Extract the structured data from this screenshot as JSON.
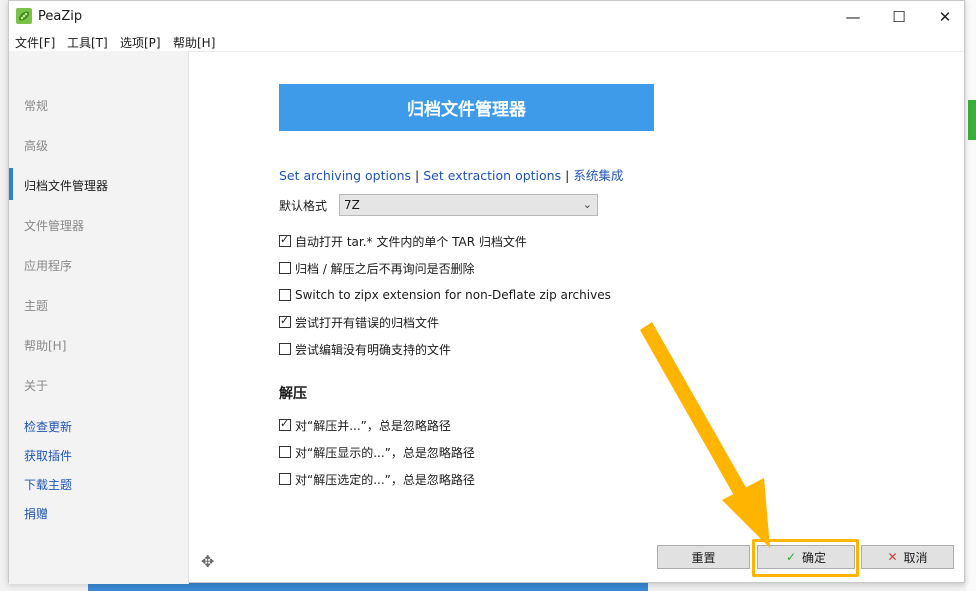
{
  "window": {
    "title": "PeaZip",
    "controls": {
      "minimize": "—",
      "maximize": "☐",
      "close": "✕"
    }
  },
  "menu": [
    "文件[F]",
    "工具[T]",
    "选项[P]",
    "帮助[H]"
  ],
  "sidebar": {
    "items": [
      "常规",
      "高级",
      "归档文件管理器",
      "文件管理器",
      "应用程序",
      "主题",
      "帮助[H]",
      "关于"
    ],
    "active_index": 2,
    "links": [
      "检查更新",
      "获取插件",
      "下载主题",
      "捐赠"
    ]
  },
  "main": {
    "header": "归档文件管理器",
    "links": [
      "Set archiving options",
      "Set extraction options",
      "系统集成"
    ],
    "link_separator": "|",
    "default_format_label": "默认格式",
    "default_format_value": "7Z",
    "options": [
      {
        "label": "自动打开 tar.* 文件内的单个 TAR 归档文件",
        "checked": true
      },
      {
        "label": "归档 / 解压之后不再询问是否删除",
        "checked": false
      },
      {
        "label": "Switch to zipx extension for non-Deflate zip archives",
        "checked": false
      },
      {
        "label": "尝试打开有错误的归档文件",
        "checked": true
      },
      {
        "label": "尝试编辑没有明确支持的文件",
        "checked": false
      }
    ],
    "extract_section_title": "解压",
    "extract_options": [
      {
        "label": "对“解压并...”，总是忽略路径",
        "checked": true
      },
      {
        "label": "对“解压显示的...”，总是忽略路径",
        "checked": false
      },
      {
        "label": "对“解压选定的...”，总是忽略路径",
        "checked": false
      }
    ]
  },
  "buttons": {
    "reset": "重置",
    "ok": "确定",
    "cancel": "取消"
  },
  "icons": {
    "app": "peazip-logo-icon",
    "move": "move-icon",
    "ok": "check-icon",
    "cancel": "cross-icon",
    "dropdown": "chevron-down-icon"
  },
  "colors": {
    "header_bg": "#3d9be9",
    "link": "#1f55b5",
    "active_marker": "#2f7fd6",
    "annotation": "#ffb400"
  }
}
